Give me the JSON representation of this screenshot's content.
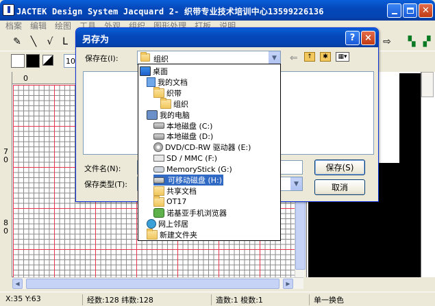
{
  "app": {
    "title": "JACTEK Design System Jacquard 2- 织带专业技术培训中心13599226136"
  },
  "menu": [
    "档案",
    "编辑",
    "绘图",
    "工具",
    "外观",
    "组织",
    "图形处理",
    "打板",
    "说明"
  ],
  "toolbar2": {
    "zoom_value": "10"
  },
  "rulers": {
    "top_label": "0",
    "left_labels": [
      "7\n0",
      "8\n0"
    ]
  },
  "statusbar": {
    "coords": "X:35 Y:63",
    "counts": "经数:128 纬数:128",
    "weft_info": "造数:1 梭数:1",
    "mode": "单一换色"
  },
  "dialog": {
    "title": "另存为",
    "save_in_label": "保存在(I):",
    "save_in_value": "组织",
    "filename_label": "文件名(N):",
    "filetype_label": "保存类型(T):",
    "save_button": "保存(S)",
    "cancel_button": "取消",
    "help_button": "?",
    "close_button": "×"
  },
  "dropdown": {
    "items": [
      {
        "label": "桌面",
        "icon": "desktop-icon",
        "indent": 0,
        "selected": false
      },
      {
        "label": "我的文档",
        "icon": "my-documents-icon",
        "indent": 1,
        "selected": false
      },
      {
        "label": "织带",
        "icon": "folder-icon",
        "indent": 2,
        "selected": false
      },
      {
        "label": "组织",
        "icon": "folder-icon",
        "indent": 3,
        "selected": false
      },
      {
        "label": "我的电脑",
        "icon": "my-computer-icon",
        "indent": 1,
        "selected": false
      },
      {
        "label": "本地磁盘 (C:)",
        "icon": "hard-disk-icon",
        "indent": 2,
        "selected": false
      },
      {
        "label": "本地磁盘 (D:)",
        "icon": "hard-disk-icon",
        "indent": 2,
        "selected": false
      },
      {
        "label": "DVD/CD-RW 驱动器 (E:)",
        "icon": "dvd-drive-icon",
        "indent": 2,
        "selected": false
      },
      {
        "label": "SD / MMC (F:)",
        "icon": "sd-card-icon",
        "indent": 2,
        "selected": false
      },
      {
        "label": "MemoryStick (G:)",
        "icon": "memory-stick-icon",
        "indent": 2,
        "selected": false
      },
      {
        "label": "可移动磁盘 (H:)",
        "icon": "removable-disk-icon",
        "indent": 2,
        "selected": true
      },
      {
        "label": "共享文档",
        "icon": "shared-folder-icon",
        "indent": 2,
        "selected": false
      },
      {
        "label": "OT17",
        "icon": "folder-icon",
        "indent": 2,
        "selected": false
      },
      {
        "label": "诺基亚手机浏览器",
        "icon": "nokia-browser-icon",
        "indent": 2,
        "selected": false
      },
      {
        "label": "网上邻居",
        "icon": "network-places-icon",
        "indent": 1,
        "selected": false
      },
      {
        "label": "新建文件夹",
        "icon": "folder-icon",
        "indent": 1,
        "selected": false
      }
    ]
  },
  "colors": {
    "xp_blue": "#0548bb",
    "grid_major": "#e7324d",
    "grid_minor": "#8a8a8a",
    "selection": "#316ac5"
  }
}
